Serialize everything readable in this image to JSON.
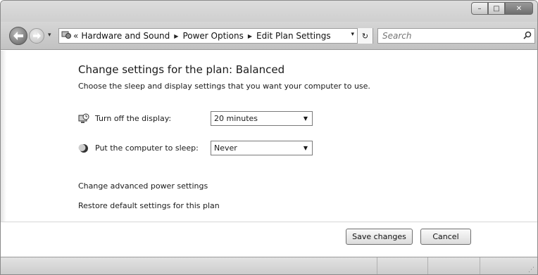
{
  "window": {
    "caption_buttons": {
      "minimize": "–",
      "maximize": "□",
      "close": "✕"
    }
  },
  "navbar": {
    "back_icon": "back-arrow-icon",
    "forward_icon": "forward-arrow-icon",
    "history_icon": "▾",
    "address_chevrons": "«",
    "breadcrumbs": [
      {
        "label": "Hardware and Sound"
      },
      {
        "label": "Power Options"
      },
      {
        "label": "Edit Plan Settings"
      }
    ],
    "crumb_separator": "▶",
    "address_dropdown": "▾",
    "refresh_icon": "↻",
    "search": {
      "placeholder": "Search",
      "value": ""
    },
    "search_icon": "⌕"
  },
  "content": {
    "title": "Change settings for the plan: Balanced",
    "subtitle": "Choose the sleep and display settings that you want your computer to use.",
    "settings": [
      {
        "label": "Turn off the display:",
        "value": "20 minutes",
        "icon": "monitor-clock-icon"
      },
      {
        "label": "Put the computer to sleep:",
        "value": "Never",
        "icon": "moon-icon"
      }
    ],
    "links": {
      "advanced": "Change advanced power settings",
      "restore": "Restore default settings for this plan"
    }
  },
  "buttons": {
    "save": "Save changes",
    "cancel": "Cancel"
  }
}
